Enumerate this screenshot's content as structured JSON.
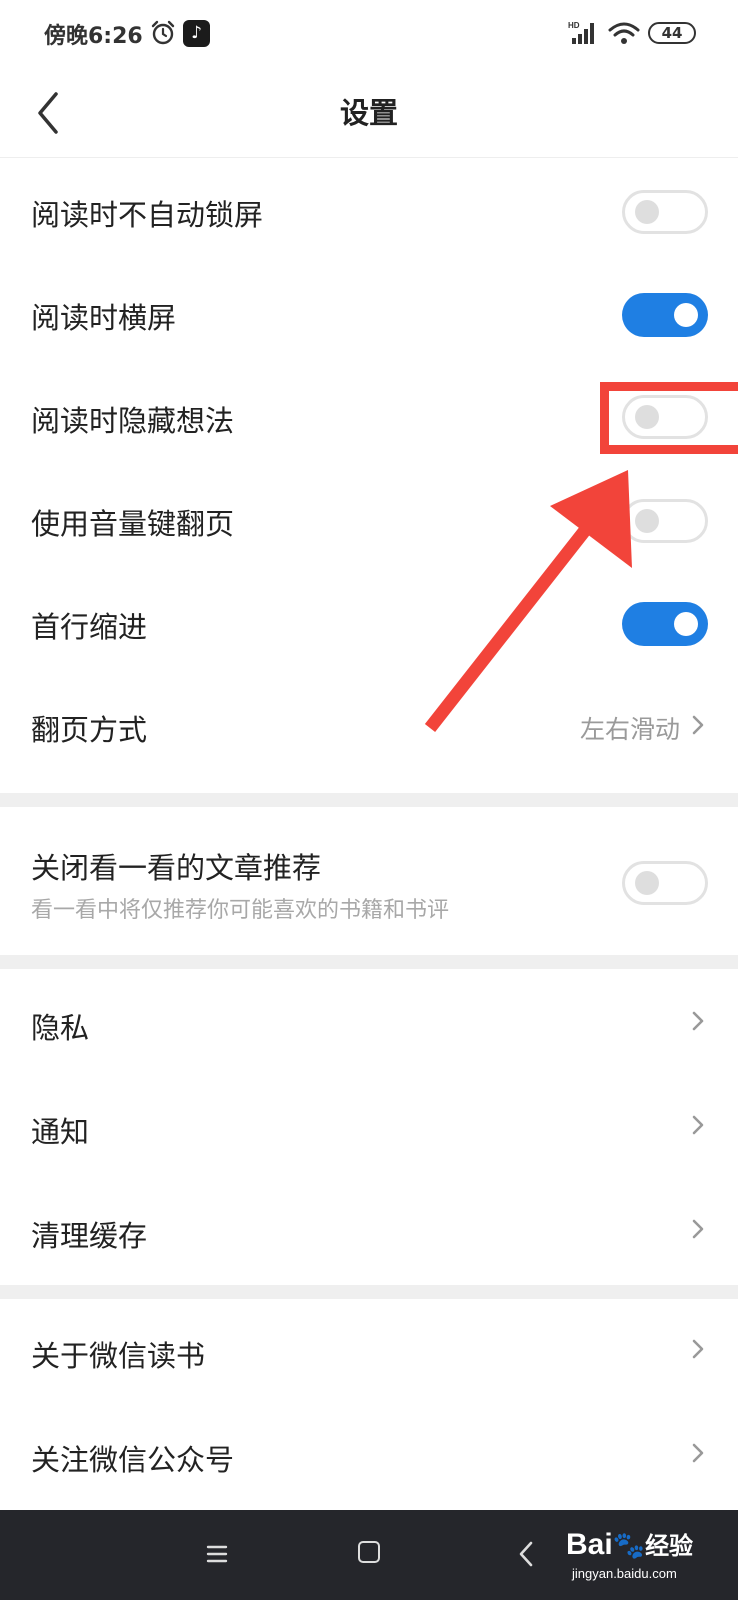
{
  "status_bar": {
    "time": "傍晚6:26",
    "alarm_icon": "alarm-clock-icon",
    "app_icon": "tiktok-icon",
    "app_glyph": "♪",
    "signal_icon": "hd-signal-icon",
    "signal_label": "HD",
    "wifi_icon": "wifi-icon",
    "battery": "44"
  },
  "header": {
    "back_icon": "chevron-left-icon",
    "title": "设置"
  },
  "reading_settings": [
    {
      "label": "阅读时不自动锁屏",
      "type": "toggle",
      "on": false
    },
    {
      "label": "阅读时横屏",
      "type": "toggle",
      "on": true
    },
    {
      "label": "阅读时隐藏想法",
      "type": "toggle",
      "on": false
    },
    {
      "label": "使用音量键翻页",
      "type": "toggle",
      "on": false
    },
    {
      "label": "首行缩进",
      "type": "toggle",
      "on": true
    },
    {
      "label": "翻页方式",
      "type": "select",
      "value": "左右滑动"
    }
  ],
  "recommendation": {
    "label": "关闭看一看的文章推荐",
    "sub": "看一看中将仅推荐你可能喜欢的书籍和书评",
    "on": false
  },
  "general_items": [
    {
      "label": "隐私"
    },
    {
      "label": "通知"
    },
    {
      "label": "清理缓存"
    }
  ],
  "about_items": [
    {
      "label": "关于微信读书"
    },
    {
      "label": "关注微信公众号"
    }
  ],
  "colors": {
    "toggle_on": "#1f7fe3",
    "annotation": "#f2443a",
    "section_divider": "#efefef",
    "system_nav": "#25262b"
  },
  "system_nav": {
    "menu_icon": "menu-icon",
    "home_icon": "home-square-icon",
    "back_icon": "back-icon"
  },
  "watermark": {
    "brand": "Bai",
    "brand_suffix": "经验",
    "url": "jingyan.baidu.com"
  }
}
